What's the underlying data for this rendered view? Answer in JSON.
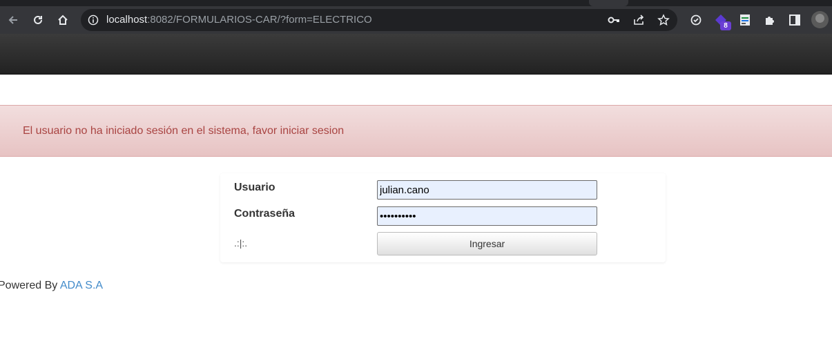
{
  "browser": {
    "url_host": "localhost",
    "url_rest": ":8082/FORMULARIOS-CAR/?form=ELECTRICO",
    "extension_badge": "8",
    "icons": [
      "back-icon",
      "reload-icon",
      "home-icon",
      "info-icon",
      "key-icon",
      "share-icon",
      "star-icon",
      "extension-icon",
      "puzzle-icon",
      "sidepanel-icon"
    ]
  },
  "alert": {
    "message": "El usuario no ha iniciado sesión en el sistema, favor iniciar sesion",
    "color": "#a94442"
  },
  "login": {
    "user_label": "Usuario",
    "user_value": "julian.cano",
    "password_label": "Contraseña",
    "password_value": "••••••••••",
    "filler_text": ".:|:.",
    "submit_label": "Ingresar"
  },
  "footer": {
    "prefix": "Powered By ",
    "link_text": "ADA S.A",
    "link_color": "#428bca"
  }
}
